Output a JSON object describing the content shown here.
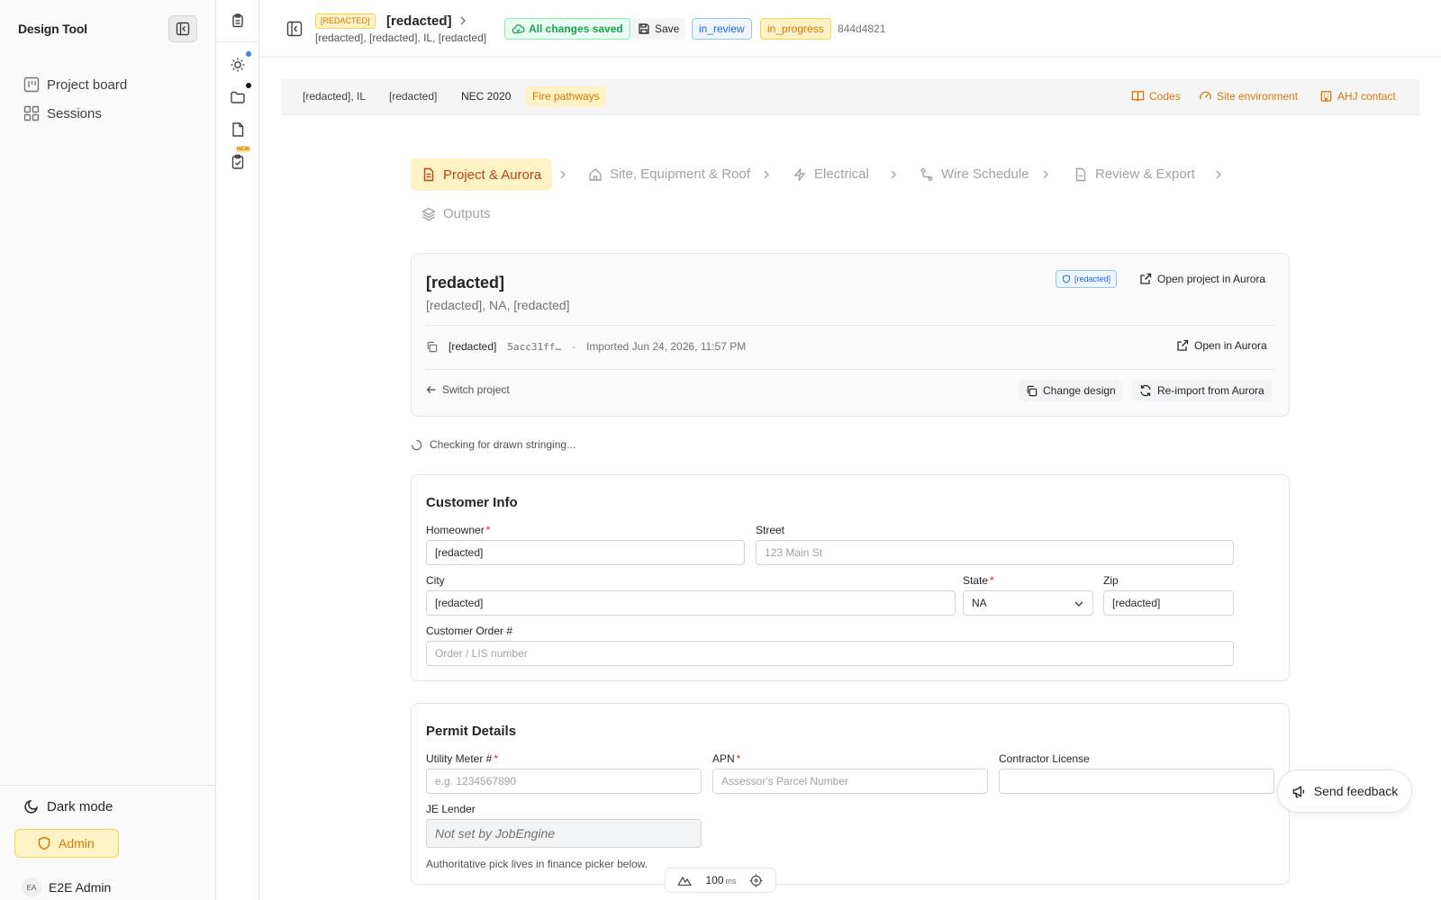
{
  "app": {
    "title": "Design Tool"
  },
  "sidebar": {
    "items": [
      {
        "label": "Project board",
        "icon": "kanban-icon"
      },
      {
        "label": "Sessions",
        "icon": "grid-icon"
      }
    ],
    "dark_mode_label": "Dark mode",
    "role_label": "Admin",
    "user": {
      "initials": "EA",
      "name": "E2E Admin"
    }
  },
  "rail": {
    "badge": "NEW"
  },
  "header": {
    "tag": "[REDACTED]",
    "title": "[redacted]",
    "subtitle": "[redacted], [redacted], IL, [redacted]",
    "saved_label": "All changes saved",
    "save_label": "Save",
    "status_review": "in_review",
    "status_progress": "in_progress",
    "hash": "844d4821"
  },
  "infobar": {
    "location": "[redacted], IL",
    "ahj": "[redacted]",
    "code": "NEC 2020",
    "fire": "Fire pathways",
    "links": [
      "Codes",
      "Site environment",
      "AHJ contact"
    ]
  },
  "steps": [
    {
      "label": "Project & Aurora",
      "icon": "document-icon",
      "active": true
    },
    {
      "label": "Site, Equipment & Roof",
      "icon": "house-icon"
    },
    {
      "label": "Electrical",
      "icon": "bolt-icon"
    },
    {
      "label": "Wire Schedule",
      "icon": "route-icon"
    },
    {
      "label": "Review & Export",
      "icon": "file-export-icon"
    },
    {
      "label": "Outputs",
      "icon": "layers-icon"
    }
  ],
  "project_card": {
    "title": "[redacted]",
    "subtitle": "[redacted], NA, [redacted]",
    "tag": "[redacted]",
    "open_project_label": "Open project in Aurora",
    "design_name": "[redacted]",
    "design_id": "5acc31ff…",
    "separator": "·",
    "imported": "Imported Jun 24, 2026, 11:57 PM",
    "open_label": "Open in Aurora",
    "switch_label": "Switch project",
    "change_design_label": "Change design",
    "reimport_label": "Re-import from Aurora"
  },
  "checking_text": "Checking for drawn stringing...",
  "customer_info": {
    "title": "Customer Info",
    "homeowner": {
      "label": "Homeowner",
      "value": "[redacted]"
    },
    "street": {
      "label": "Street",
      "placeholder": "123 Main St"
    },
    "city": {
      "label": "City",
      "value": "[redacted]"
    },
    "state": {
      "label": "State",
      "value": "NA"
    },
    "zip": {
      "label": "Zip",
      "value": "[redacted]"
    },
    "order": {
      "label": "Customer Order #",
      "placeholder": "Order / LIS number"
    }
  },
  "permit": {
    "title": "Permit Details",
    "meter": {
      "label": "Utility Meter #",
      "placeholder": "e.g. 1234567890"
    },
    "apn": {
      "label": "APN",
      "placeholder": "Assessor's Parcel Number"
    },
    "license": {
      "label": "Contractor License",
      "value": ""
    },
    "lender": {
      "label": "JE Lender",
      "value": "Not set by JobEngine"
    },
    "hint": "Authoritative pick lives in finance picker below."
  },
  "feedback_label": "Send feedback",
  "perf": {
    "value": "100",
    "unit": "ms"
  },
  "colors": {
    "accent": "#d97706",
    "success": "#16a34a",
    "info": "#2563eb",
    "required": "#dc2626"
  }
}
